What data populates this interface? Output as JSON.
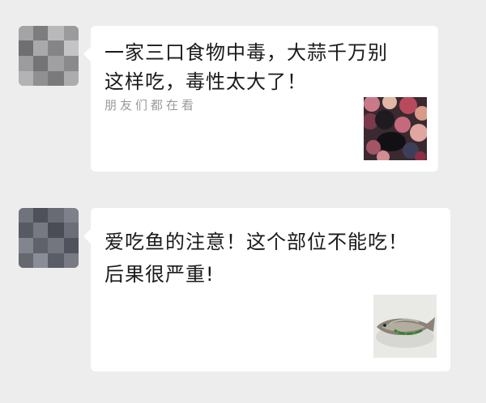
{
  "messages": [
    {
      "title": "一家三口食物中毒，大蒜千万别这样吃，毒性太大了！",
      "source": "朋友们都在看",
      "thumbnail": "crowd-photo"
    },
    {
      "title": "爱吃鱼的注意！这个部位不能吃！后果很严重!",
      "source": "",
      "thumbnail": "fish-photo"
    }
  ],
  "colors": {
    "background": "#ededed",
    "bubble": "#ffffff",
    "title_text": "#1a1a1a",
    "source_text": "#9a9a9a"
  }
}
